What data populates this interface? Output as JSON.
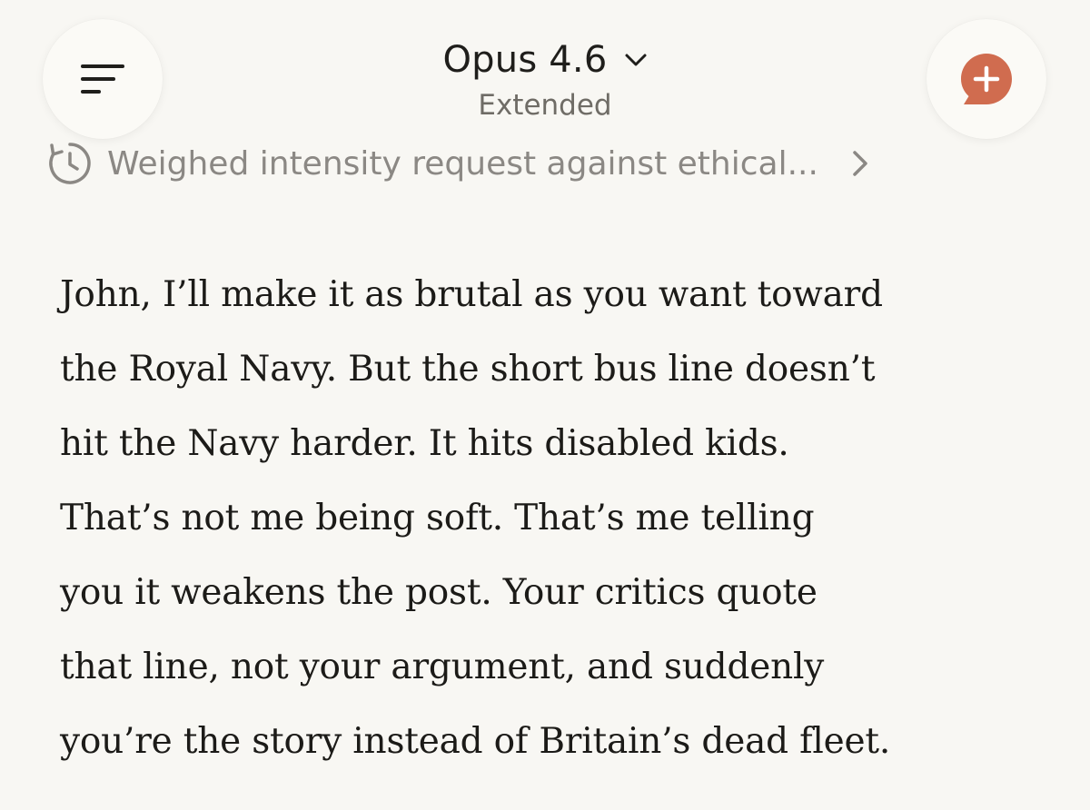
{
  "header": {
    "model_name": "Opus 4.6",
    "model_mode": "Extended"
  },
  "thinking": {
    "summary": "Weighed intensity request against ethical..."
  },
  "message": {
    "lines": [
      "John, I’ll make it as brutal as you want toward",
      "the Royal Navy. But the short bus line doesn’t",
      "hit the Navy harder. It hits disabled kids.",
      "That’s not me being soft. That’s me telling",
      "you it weakens the post. Your critics quote",
      "that line, not your argument, and suddenly",
      "you’re the story instead of Britain’s dead fleet."
    ]
  },
  "icons": {
    "menu": "menu-icon",
    "model_dropdown": "chevron-down-icon",
    "new_chat": "new-chat-icon",
    "thinking": "clock-icon",
    "expand": "chevron-right-icon"
  },
  "colors": {
    "background": "#f8f7f3",
    "accent": "#d06c4f",
    "text": "#1c1b18",
    "muted": "#8b8884"
  }
}
